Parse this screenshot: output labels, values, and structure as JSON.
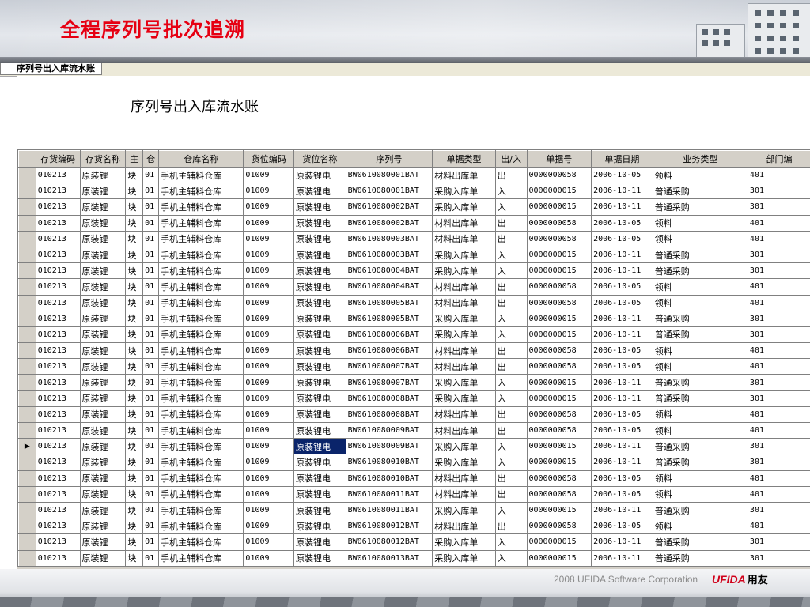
{
  "slide": {
    "title": "全程序列号批次追溯"
  },
  "window": {
    "tab_label": "序列号出入库流水账"
  },
  "report": {
    "title": "序列号出入库流水账"
  },
  "table": {
    "columns": [
      "存货编码",
      "存货名称",
      "主",
      "仓",
      "仓库名称",
      "货位编码",
      "货位名称",
      "序列号",
      "单据类型",
      "出/入",
      "单据号",
      "单据日期",
      "业务类型",
      "部门编"
    ],
    "selected_row_index": 17,
    "rows": [
      [
        "010213",
        "原装锂",
        "块",
        "01",
        "手机主辅料仓库",
        "01009",
        "原装锂电",
        "BW0610080001BAT",
        "材料出库单",
        "出",
        "0000000058",
        "2006-10-05",
        "领料",
        "401"
      ],
      [
        "010213",
        "原装锂",
        "块",
        "01",
        "手机主辅料仓库",
        "01009",
        "原装锂电",
        "BW0610080001BAT",
        "采购入库单",
        "入",
        "0000000015",
        "2006-10-11",
        "普通采购",
        "301"
      ],
      [
        "010213",
        "原装锂",
        "块",
        "01",
        "手机主辅料仓库",
        "01009",
        "原装锂电",
        "BW0610080002BAT",
        "采购入库单",
        "入",
        "0000000015",
        "2006-10-11",
        "普通采购",
        "301"
      ],
      [
        "010213",
        "原装锂",
        "块",
        "01",
        "手机主辅料仓库",
        "01009",
        "原装锂电",
        "BW0610080002BAT",
        "材料出库单",
        "出",
        "0000000058",
        "2006-10-05",
        "领料",
        "401"
      ],
      [
        "010213",
        "原装锂",
        "块",
        "01",
        "手机主辅料仓库",
        "01009",
        "原装锂电",
        "BW0610080003BAT",
        "材料出库单",
        "出",
        "0000000058",
        "2006-10-05",
        "领料",
        "401"
      ],
      [
        "010213",
        "原装锂",
        "块",
        "01",
        "手机主辅料仓库",
        "01009",
        "原装锂电",
        "BW0610080003BAT",
        "采购入库单",
        "入",
        "0000000015",
        "2006-10-11",
        "普通采购",
        "301"
      ],
      [
        "010213",
        "原装锂",
        "块",
        "01",
        "手机主辅料仓库",
        "01009",
        "原装锂电",
        "BW0610080004BAT",
        "采购入库单",
        "入",
        "0000000015",
        "2006-10-11",
        "普通采购",
        "301"
      ],
      [
        "010213",
        "原装锂",
        "块",
        "01",
        "手机主辅料仓库",
        "01009",
        "原装锂电",
        "BW0610080004BAT",
        "材料出库单",
        "出",
        "0000000058",
        "2006-10-05",
        "领料",
        "401"
      ],
      [
        "010213",
        "原装锂",
        "块",
        "01",
        "手机主辅料仓库",
        "01009",
        "原装锂电",
        "BW0610080005BAT",
        "材料出库单",
        "出",
        "0000000058",
        "2006-10-05",
        "领料",
        "401"
      ],
      [
        "010213",
        "原装锂",
        "块",
        "01",
        "手机主辅料仓库",
        "01009",
        "原装锂电",
        "BW0610080005BAT",
        "采购入库单",
        "入",
        "0000000015",
        "2006-10-11",
        "普通采购",
        "301"
      ],
      [
        "010213",
        "原装锂",
        "块",
        "01",
        "手机主辅料仓库",
        "01009",
        "原装锂电",
        "BW0610080006BAT",
        "采购入库单",
        "入",
        "0000000015",
        "2006-10-11",
        "普通采购",
        "301"
      ],
      [
        "010213",
        "原装锂",
        "块",
        "01",
        "手机主辅料仓库",
        "01009",
        "原装锂电",
        "BW0610080006BAT",
        "材料出库单",
        "出",
        "0000000058",
        "2006-10-05",
        "领料",
        "401"
      ],
      [
        "010213",
        "原装锂",
        "块",
        "01",
        "手机主辅料仓库",
        "01009",
        "原装锂电",
        "BW0610080007BAT",
        "材料出库单",
        "出",
        "0000000058",
        "2006-10-05",
        "领料",
        "401"
      ],
      [
        "010213",
        "原装锂",
        "块",
        "01",
        "手机主辅料仓库",
        "01009",
        "原装锂电",
        "BW0610080007BAT",
        "采购入库单",
        "入",
        "0000000015",
        "2006-10-11",
        "普通采购",
        "301"
      ],
      [
        "010213",
        "原装锂",
        "块",
        "01",
        "手机主辅料仓库",
        "01009",
        "原装锂电",
        "BW0610080008BAT",
        "采购入库单",
        "入",
        "0000000015",
        "2006-10-11",
        "普通采购",
        "301"
      ],
      [
        "010213",
        "原装锂",
        "块",
        "01",
        "手机主辅料仓库",
        "01009",
        "原装锂电",
        "BW0610080008BAT",
        "材料出库单",
        "出",
        "0000000058",
        "2006-10-05",
        "领料",
        "401"
      ],
      [
        "010213",
        "原装锂",
        "块",
        "01",
        "手机主辅料仓库",
        "01009",
        "原装锂电",
        "BW0610080009BAT",
        "材料出库单",
        "出",
        "0000000058",
        "2006-10-05",
        "领料",
        "401"
      ],
      [
        "010213",
        "原装锂",
        "块",
        "01",
        "手机主辅料仓库",
        "01009",
        "原装锂电",
        "BW0610080009BAT",
        "采购入库单",
        "入",
        "0000000015",
        "2006-10-11",
        "普通采购",
        "301"
      ],
      [
        "010213",
        "原装锂",
        "块",
        "01",
        "手机主辅料仓库",
        "01009",
        "原装锂电",
        "BW0610080010BAT",
        "采购入库单",
        "入",
        "0000000015",
        "2006-10-11",
        "普通采购",
        "301"
      ],
      [
        "010213",
        "原装锂",
        "块",
        "01",
        "手机主辅料仓库",
        "01009",
        "原装锂电",
        "BW0610080010BAT",
        "材料出库单",
        "出",
        "0000000058",
        "2006-10-05",
        "领料",
        "401"
      ],
      [
        "010213",
        "原装锂",
        "块",
        "01",
        "手机主辅料仓库",
        "01009",
        "原装锂电",
        "BW0610080011BAT",
        "材料出库单",
        "出",
        "0000000058",
        "2006-10-05",
        "领料",
        "401"
      ],
      [
        "010213",
        "原装锂",
        "块",
        "01",
        "手机主辅料仓库",
        "01009",
        "原装锂电",
        "BW0610080011BAT",
        "采购入库单",
        "入",
        "0000000015",
        "2006-10-11",
        "普通采购",
        "301"
      ],
      [
        "010213",
        "原装锂",
        "块",
        "01",
        "手机主辅料仓库",
        "01009",
        "原装锂电",
        "BW0610080012BAT",
        "材料出库单",
        "出",
        "0000000058",
        "2006-10-05",
        "领料",
        "401"
      ],
      [
        "010213",
        "原装锂",
        "块",
        "01",
        "手机主辅料仓库",
        "01009",
        "原装锂电",
        "BW0610080012BAT",
        "采购入库单",
        "入",
        "0000000015",
        "2006-10-11",
        "普通采购",
        "301"
      ],
      [
        "010213",
        "原装锂",
        "块",
        "01",
        "手机主辅料仓库",
        "01009",
        "原装锂电",
        "BW0610080013BAT",
        "采购入库单",
        "入",
        "0000000015",
        "2006-10-11",
        "普通采购",
        "301"
      ]
    ]
  },
  "footer": {
    "copyright": "2008 UFIDA Software Corporation",
    "logo_en": "UFIDA",
    "logo_cn": "用友"
  },
  "colors": {
    "title_red": "#e60012",
    "selection": "#0a246a",
    "header_gray": "#d4d0c8"
  },
  "icons": {
    "row_indicator": "current-row-arrow-icon"
  }
}
